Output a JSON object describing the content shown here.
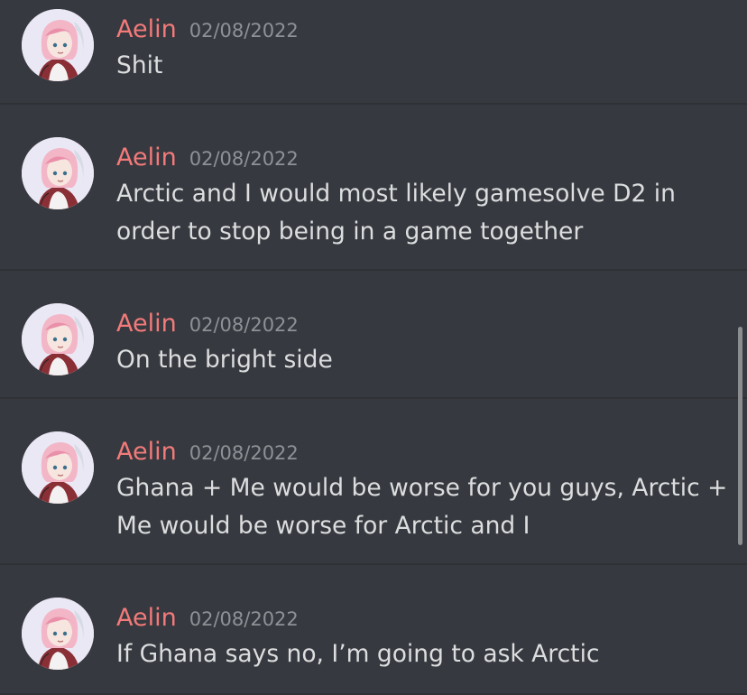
{
  "messages": [
    {
      "author": "Aelin",
      "timestamp": "02/08/2022",
      "text": "Shit",
      "avatar_icon": "user-avatar-icon"
    },
    {
      "author": "Aelin",
      "timestamp": "02/08/2022",
      "text": "Arctic and I would most likely gamesolve D2 in\norder to stop being in a game together",
      "avatar_icon": "user-avatar-icon"
    },
    {
      "author": "Aelin",
      "timestamp": "02/08/2022",
      "text": "On the bright side",
      "avatar_icon": "user-avatar-icon"
    },
    {
      "author": "Aelin",
      "timestamp": "02/08/2022",
      "text": "Ghana + Me would be worse for you guys, Arctic +\nMe would be worse for Arctic and I",
      "avatar_icon": "user-avatar-icon"
    },
    {
      "author": "Aelin",
      "timestamp": "02/08/2022",
      "text": "If Ghana says no, I’m going to ask Arctic",
      "avatar_icon": "user-avatar-icon"
    }
  ],
  "colors": {
    "background": "#36393f",
    "author": "#f47a7a",
    "timestamp": "#8e9297",
    "text": "#dcddde",
    "divider": "#2f3136",
    "scrollbar": "#8b8d91"
  }
}
